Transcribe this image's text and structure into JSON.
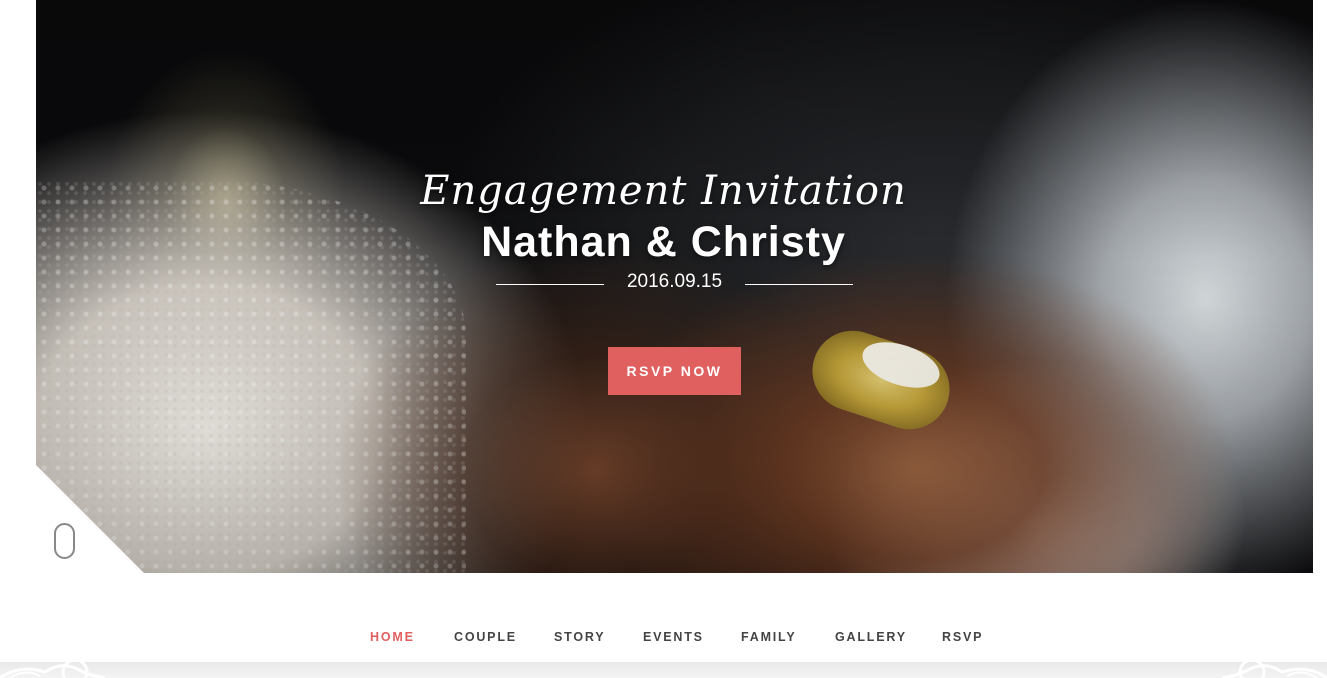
{
  "hero": {
    "subtitle": "Engagement Invitation",
    "names": "Nathan & Christy",
    "date": "2016.09.15",
    "rsvp_button_label": "RSVP NOW"
  },
  "nav": {
    "items": [
      {
        "label": "HOME",
        "active": true
      },
      {
        "label": "COUPLE",
        "active": false
      },
      {
        "label": "STORY",
        "active": false
      },
      {
        "label": "EVENTS",
        "active": false
      },
      {
        "label": "FAMILY",
        "active": false
      },
      {
        "label": "GALLERY",
        "active": false
      },
      {
        "label": "RSVP",
        "active": false
      }
    ]
  },
  "colors": {
    "accent": "#e05f5f",
    "nav_text": "#444444",
    "hero_text": "#ffffff"
  },
  "icons": {
    "scroll_indicator": "mouse-scroll-icon",
    "ornaments": "floral-ornament-icon"
  }
}
